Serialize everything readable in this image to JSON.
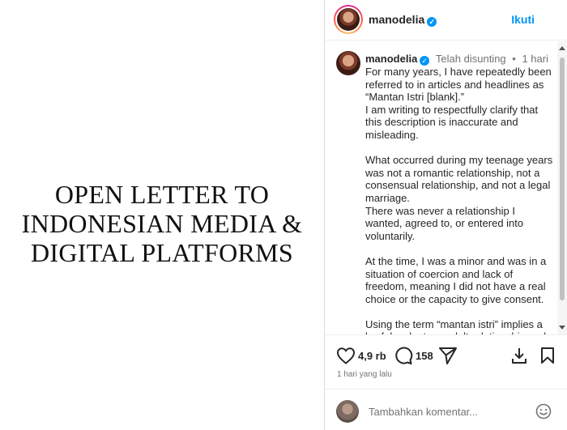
{
  "post_image": {
    "headline_lines": [
      "OPEN LETTER TO",
      "INDONESIAN MEDIA &",
      "DIGITAL PLATFORMS"
    ]
  },
  "header": {
    "username": "manodelia",
    "follow_label": "Ikuti"
  },
  "caption": {
    "username": "manodelia",
    "edited_label": "Telah disunting",
    "time": "1 hari",
    "separator": "•",
    "lines": [
      "For many years, I have repeatedly been referred to in articles and headlines as “Mantan Istri [blank].”",
      "I am writing to respectfully clarify that this description is inaccurate and misleading.",
      "",
      "What occurred during my teenage years was not a romantic relationship, not a consensual relationship, and not a legal marriage.",
      "There was never a relationship I wanted, agreed to, or entered into voluntarily.",
      "",
      "At the time, I was a minor and was in a situation of coercion and lack of freedom, meaning I did not have a real choice or the capacity to give consent.",
      "",
      "Using the term “mantan istri” implies a lawful, voluntary, adult relationship and"
    ]
  },
  "actions": {
    "likes": "4,9 rb",
    "comments": "158",
    "time_ago": "1 hari yang lalu"
  },
  "add_comment": {
    "placeholder": "Tambahkan komentar..."
  },
  "colors": {
    "accent": "#0095f6",
    "muted": "#737373",
    "text": "#262626"
  }
}
